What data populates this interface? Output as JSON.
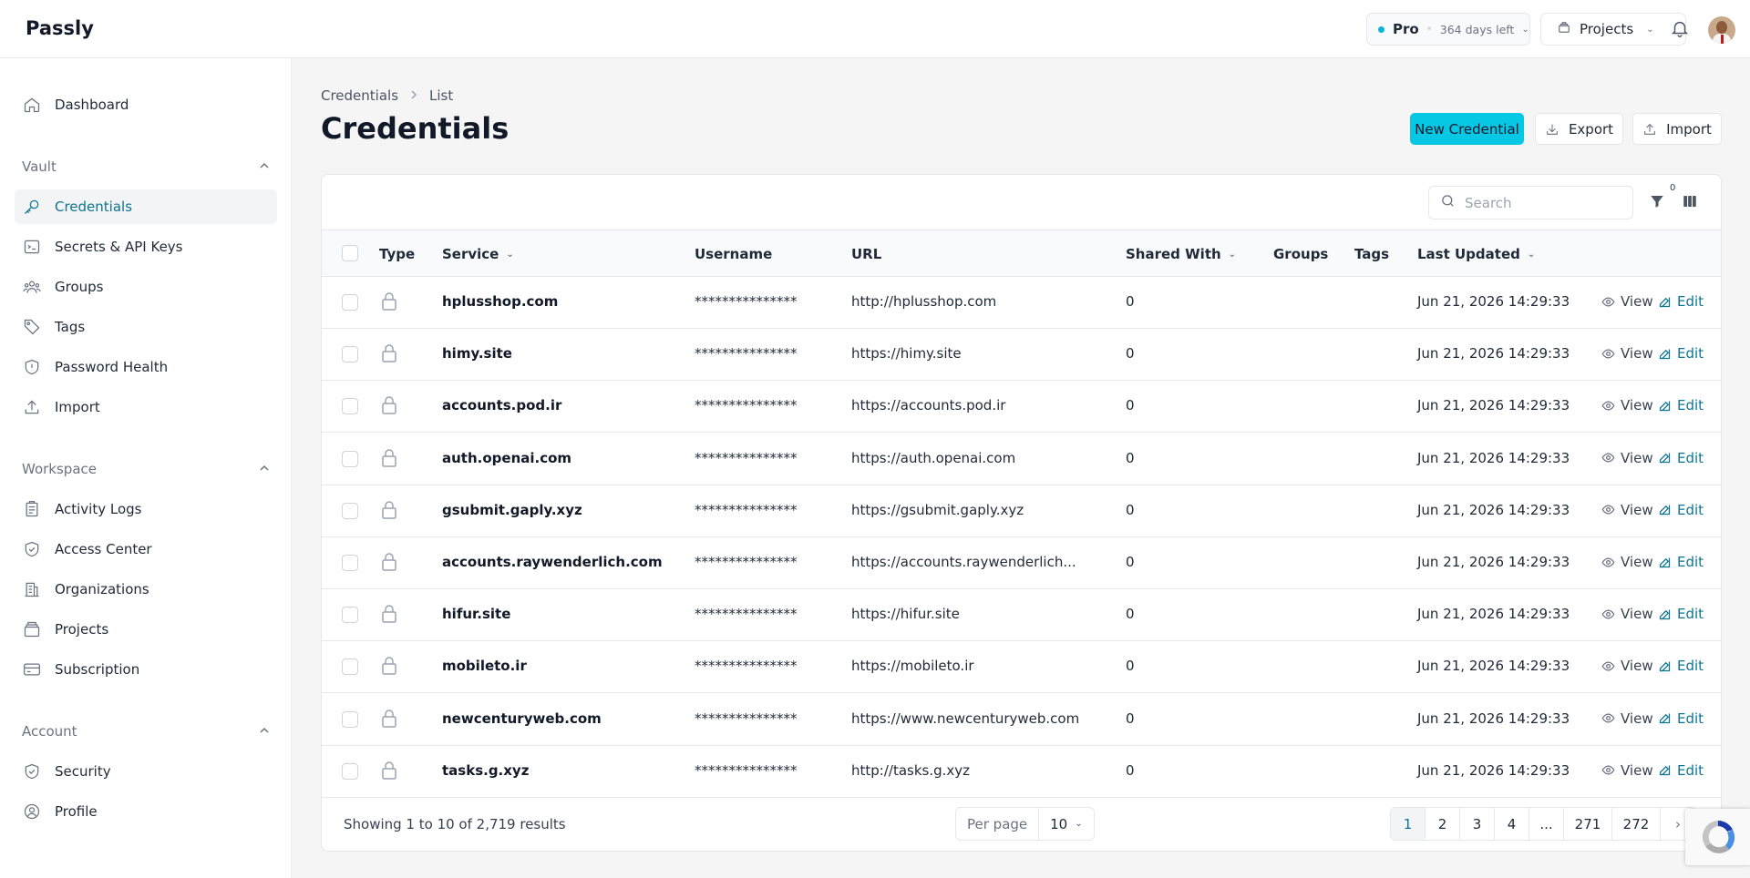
{
  "app": {
    "brand": "Passly"
  },
  "topbar": {
    "plan_name": "Pro",
    "plan_days": "364 days left",
    "projects_label": "Projects",
    "accent_color": "#06c8e4"
  },
  "sidebar": {
    "dashboard": "Dashboard",
    "sections": {
      "vault": "Vault",
      "workspace": "Workspace",
      "account": "Account"
    },
    "vault_items": [
      {
        "label": "Credentials",
        "icon": "key-icon",
        "active": true
      },
      {
        "label": "Secrets & API Keys",
        "icon": "terminal-icon"
      },
      {
        "label": "Groups",
        "icon": "users-icon"
      },
      {
        "label": "Tags",
        "icon": "tag-icon"
      },
      {
        "label": "Password Health",
        "icon": "shield-alert-icon"
      },
      {
        "label": "Import",
        "icon": "upload-icon"
      }
    ],
    "workspace_items": [
      {
        "label": "Activity Logs",
        "icon": "clipboard-icon"
      },
      {
        "label": "Access Center",
        "icon": "shield-check-icon"
      },
      {
        "label": "Organizations",
        "icon": "building-icon"
      },
      {
        "label": "Projects",
        "icon": "layers-icon"
      },
      {
        "label": "Subscription",
        "icon": "credit-card-icon"
      }
    ],
    "account_items": [
      {
        "label": "Security",
        "icon": "shield-check-icon"
      },
      {
        "label": "Profile",
        "icon": "user-circle-icon"
      }
    ]
  },
  "page": {
    "breadcrumb": [
      "Credentials",
      "List"
    ],
    "title": "Credentials",
    "new_button": "New Credential",
    "export_button": "Export",
    "import_button": "Import",
    "search_placeholder": "Search",
    "filter_count": "0"
  },
  "table": {
    "headers": {
      "type": "Type",
      "service": "Service",
      "username": "Username",
      "url": "URL",
      "shared_with": "Shared With",
      "groups": "Groups",
      "tags": "Tags",
      "last_updated": "Last Updated"
    },
    "action_view": "View",
    "action_edit": "Edit",
    "rows": [
      {
        "service": "hplusshop.com",
        "username": "***************",
        "url": "http://hplusshop.com",
        "shared": "0",
        "updated": "Jun 21, 2026 14:29:33"
      },
      {
        "service": "himy.site",
        "username": "***************",
        "url": "https://himy.site",
        "shared": "0",
        "updated": "Jun 21, 2026 14:29:33"
      },
      {
        "service": "accounts.pod.ir",
        "username": "***************",
        "url": "https://accounts.pod.ir",
        "shared": "0",
        "updated": "Jun 21, 2026 14:29:33"
      },
      {
        "service": "auth.openai.com",
        "username": "***************",
        "url": "https://auth.openai.com",
        "shared": "0",
        "updated": "Jun 21, 2026 14:29:33"
      },
      {
        "service": "gsubmit.gaply.xyz",
        "username": "***************",
        "url": "https://gsubmit.gaply.xyz",
        "shared": "0",
        "updated": "Jun 21, 2026 14:29:33"
      },
      {
        "service": "accounts.raywenderlich.com",
        "username": "***************",
        "url": "https://accounts.raywenderlich...",
        "shared": "0",
        "updated": "Jun 21, 2026 14:29:33"
      },
      {
        "service": "hifur.site",
        "username": "***************",
        "url": "https://hifur.site",
        "shared": "0",
        "updated": "Jun 21, 2026 14:29:33"
      },
      {
        "service": "mobileto.ir",
        "username": "***************",
        "url": "https://mobileto.ir",
        "shared": "0",
        "updated": "Jun 21, 2026 14:29:33"
      },
      {
        "service": "newcenturyweb.com",
        "username": "***************",
        "url": "https://www.newcenturyweb.com",
        "shared": "0",
        "updated": "Jun 21, 2026 14:29:33"
      },
      {
        "service": "tasks.g.xyz",
        "username": "***************",
        "url": "http://tasks.g.xyz",
        "shared": "0",
        "updated": "Jun 21, 2026 14:29:33"
      }
    ]
  },
  "footer": {
    "showing": "Showing 1 to 10 of 2,719 results",
    "per_page_label": "Per page",
    "per_page_value": "10",
    "pages": [
      "1",
      "2",
      "3",
      "4",
      "...",
      "271",
      "272"
    ],
    "current_page": "1"
  }
}
